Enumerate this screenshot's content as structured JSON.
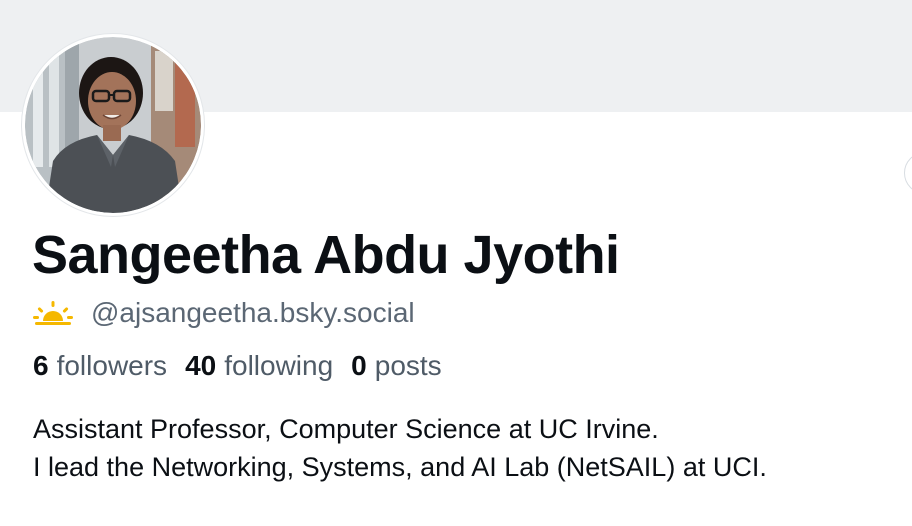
{
  "profile": {
    "display_name": "Sangeetha Abdu Jyothi",
    "handle": "@ajsangeetha.bsky.social",
    "handle_badge_icon": "sun-icon",
    "accent_color": "#f5b800"
  },
  "stats": {
    "followers_count": "6",
    "followers_label": "followers",
    "following_count": "40",
    "following_label": "following",
    "posts_count": "0",
    "posts_label": "posts"
  },
  "bio": {
    "line1": "Assistant Professor, Computer Science at UC Irvine.",
    "line2": "I lead the Networking, Systems, and AI Lab (NetSAIL) at UCI."
  },
  "colors": {
    "banner": "#eef0f2",
    "text_primary": "#0b0f14",
    "text_secondary": "#5b6774"
  }
}
